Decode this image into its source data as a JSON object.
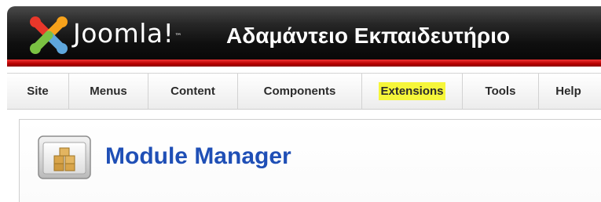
{
  "header": {
    "brand": "Joomla!",
    "brand_tm": "™",
    "site_name": "Αδαμάντειο Εκπαιδευτήριο"
  },
  "menu": {
    "items": [
      {
        "label": "Site"
      },
      {
        "label": "Menus"
      },
      {
        "label": "Content"
      },
      {
        "label": "Components"
      },
      {
        "label": "Extensions",
        "highlighted": true
      },
      {
        "label": "Tools"
      },
      {
        "label": "Help"
      }
    ]
  },
  "page": {
    "title": "Module Manager",
    "icon": "module-manager-icon"
  },
  "colors": {
    "header_dark": "#0f0f0f",
    "header_red": "#b70000",
    "title_blue": "#1f4fb6",
    "highlight": "#f6f63a"
  }
}
